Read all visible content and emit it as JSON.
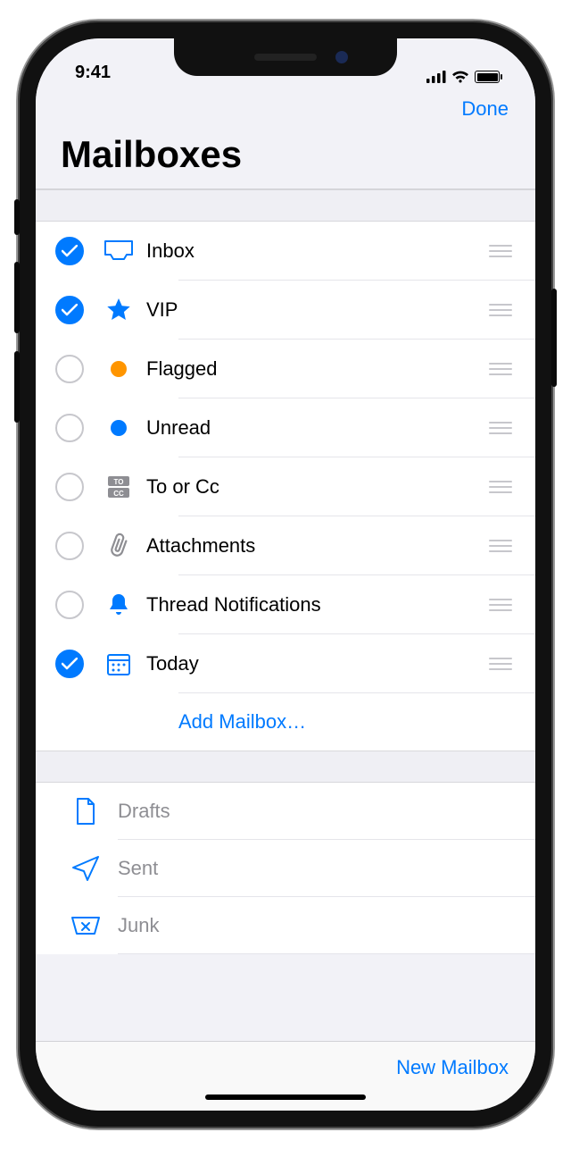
{
  "statusbar": {
    "time": "9:41"
  },
  "nav": {
    "done": "Done",
    "title": "Mailboxes"
  },
  "mailboxes": {
    "items": [
      {
        "label": "Inbox",
        "checked": true,
        "icon": "inbox-icon"
      },
      {
        "label": "VIP",
        "checked": true,
        "icon": "star-icon"
      },
      {
        "label": "Flagged",
        "checked": false,
        "icon": "flag-dot-orange-icon"
      },
      {
        "label": "Unread",
        "checked": false,
        "icon": "unread-dot-blue-icon"
      },
      {
        "label": "To or Cc",
        "checked": false,
        "icon": "to-cc-icon"
      },
      {
        "label": "Attachments",
        "checked": false,
        "icon": "paperclip-icon"
      },
      {
        "label": "Thread Notifications",
        "checked": false,
        "icon": "bell-icon"
      },
      {
        "label": "Today",
        "checked": true,
        "icon": "calendar-icon"
      }
    ],
    "add_label": "Add Mailbox…"
  },
  "account_boxes": {
    "items": [
      {
        "label": "Drafts",
        "icon": "document-icon"
      },
      {
        "label": "Sent",
        "icon": "paperplane-icon"
      },
      {
        "label": "Junk",
        "icon": "junk-icon"
      }
    ]
  },
  "toolbar": {
    "new_mailbox": "New Mailbox"
  },
  "colors": {
    "accent": "#007aff",
    "orange": "#ff9500",
    "gray": "#8e8e93"
  }
}
